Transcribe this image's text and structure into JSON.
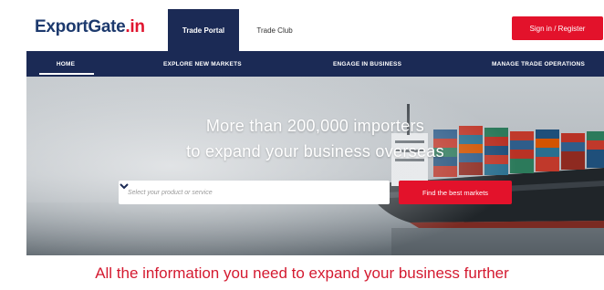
{
  "header": {
    "logo_main": "ExportGate",
    "logo_suffix": ".in",
    "tab_active_label": "Trade Portal",
    "tab_other_label": "Trade Club",
    "signin_label": "Sign in / Register"
  },
  "nav": {
    "items": [
      "HOME",
      "EXPLORE NEW MARKETS",
      "ENGAGE IN BUSINESS",
      "MANAGE TRADE OPERATIONS"
    ]
  },
  "hero": {
    "headline_line1": "More than 200,000 importers",
    "headline_line2": "to expand your business overseas",
    "search_placeholder": "Select your product or service",
    "find_button_label": "Find the best markets"
  },
  "tagline": "All the information you need to expand your business further",
  "colors": {
    "brand_navy": "#1b2a55",
    "brand_red": "#e3122b",
    "tagline_red": "#d41a30"
  },
  "icons": {
    "search_dropdown": "chevron-down-icon",
    "hero_image": "cargo-ship-image"
  }
}
